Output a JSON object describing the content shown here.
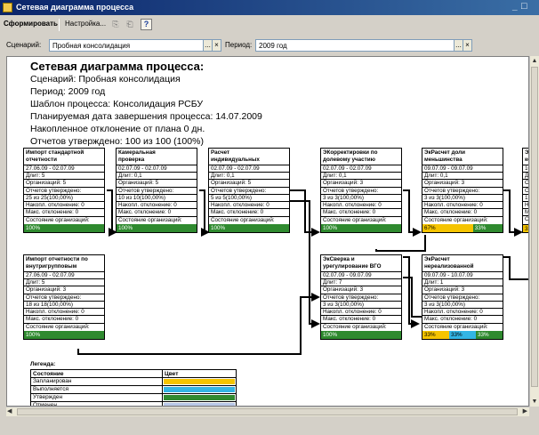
{
  "window": {
    "title": "Сетевая диаграмма процесса"
  },
  "toolbar": {
    "generate_label": "Сформировать",
    "settings_label": "Настройка...",
    "help_label": "?"
  },
  "params": {
    "scenario_label": "Сценарий:",
    "scenario_value": "Пробная консолидация",
    "period_label": "Период:",
    "period_value": "2009 год",
    "btn_select": "...",
    "btn_clear": "×"
  },
  "report": {
    "heading": "Сетевая диаграмма процесса:",
    "scenario": "Сценарий: Пробная консолидация",
    "period": "Период: 2009 год",
    "template": "Шаблон процесса: Консолидация РСБУ",
    "planned_end": "Планируемая дата завершения процесса: 14.07.2009",
    "deviation": "Накопленное отклонение от плана 0 дн.",
    "approved": "Отчетов утверждено: 100 из 100 (100%)"
  },
  "status_label": "Состояние организаций:",
  "colors": {
    "done": "#2f8a2f",
    "planned": "#f5c400",
    "in_progress": "#33b5e5",
    "approved": "#2f8a2f",
    "cancelled": "#b9c8e8",
    "suspended": "#6e6e6e"
  },
  "boxes": [
    {
      "id": "b1",
      "title1": "Импорт стандартной",
      "title2": "отчетности",
      "dates": "27.06.09 - 02.07.09",
      "duration": "Длит: 5",
      "orgs": "Организаций: 5",
      "approved_label": "Отчетов утверждено:",
      "approved_value": "25 из 25(100,00%)",
      "acc_dev": "Накопл. отклонение: 0",
      "max_dev": "Макс. отклонение: 0",
      "segments": [
        {
          "text": "100%",
          "color": "done"
        }
      ]
    },
    {
      "id": "b2",
      "title1": "Камеральная",
      "title2": "проверка",
      "dates": "02.07.09 - 02.07.09",
      "duration": "Длит: 0,1",
      "orgs": "Организаций: 5",
      "approved_label": "Отчетов утверждено:",
      "approved_value": "10 из 10(100,00%)",
      "acc_dev": "Накопл. отклонение: 0",
      "max_dev": "Макс. отклонение: 0",
      "segments": [
        {
          "text": "100%",
          "color": "done"
        }
      ]
    },
    {
      "id": "b3",
      "title1": "Расчет",
      "title2": "индивидуальных",
      "dates": "02.07.09 - 02.07.09",
      "duration": "Длит: 0,1",
      "orgs": "Организаций: 5",
      "approved_label": "Отчетов утверждено:",
      "approved_value": "5 из 5(100,00%)",
      "acc_dev": "Накопл. отклонение: 0",
      "max_dev": "Макс. отклонение: 0",
      "segments": [
        {
          "text": "100%",
          "color": "done"
        }
      ]
    },
    {
      "id": "b4",
      "title1": "ЭКорректировки по",
      "title2": "долевому участию",
      "dates": "02.07.09 - 02.07.09",
      "duration": "Длит: 0,1",
      "orgs": "Организаций: 3",
      "approved_label": "Отчетов утверждено:",
      "approved_value": "3 из 3(100,00%)",
      "acc_dev": "Накопл. отклонение: 0",
      "max_dev": "Макс. отклонение: 0",
      "segments": [
        {
          "text": "100%",
          "color": "done"
        }
      ]
    },
    {
      "id": "b5",
      "title1": "ЭкРасчет доли",
      "title2": "меньшинства",
      "dates": "09.07.09 - 09.07.09",
      "duration": "Длит: 0,1",
      "orgs": "Организаций: 3",
      "approved_label": "Отчетов утверждено:",
      "approved_value": "3 из 3(100,00%)",
      "acc_dev": "Накопл. отклонение: 0",
      "max_dev": "Макс. отклонение: 0",
      "segments": [
        {
          "text": "67%",
          "color": "planned"
        },
        {
          "text": "33%",
          "color": "done"
        }
      ]
    },
    {
      "id": "b6",
      "title1": "Импорт отчетности по",
      "title2": "внутригрупповым",
      "dates": "27.06.09 - 02.07.09",
      "duration": "Длит: 5",
      "orgs": "Организаций: 3",
      "approved_label": "Отчетов утверждено:",
      "approved_value": "18 из 18(100,00%)",
      "acc_dev": "Накопл. отклонение: 0",
      "max_dev": "Макс. отклонение: 0",
      "segments": [
        {
          "text": "100%",
          "color": "done"
        }
      ]
    },
    {
      "id": "b7",
      "title1": "ЭкСверка и",
      "title2": "урегулирование ВГО",
      "dates": "02.07.09 - 09.07.09",
      "duration": "Длит: 7",
      "orgs": "Организаций: 3",
      "approved_label": "Отчетов утверждено:",
      "approved_value": "3 из 3(100,00%)",
      "acc_dev": "Накопл. отклонение: 0",
      "max_dev": "Макс. отклонение: 0",
      "segments": [
        {
          "text": "100%",
          "color": "done"
        }
      ]
    },
    {
      "id": "b8",
      "title1": "ЭкРасчет",
      "title2": "нереализованной",
      "dates": "09.07.09 - 10.07.09",
      "duration": "Длит: 1",
      "orgs": "Организаций: 3",
      "approved_label": "Отчетов утверждено:",
      "approved_value": "3 из 3(100,00%)",
      "acc_dev": "Накопл. отклонение: 0",
      "max_dev": "Макс. отклонение: 0",
      "segments": [
        {
          "text": "33%",
          "color": "planned"
        },
        {
          "text": "33%",
          "color": "in_progress"
        },
        {
          "text": "33%",
          "color": "done"
        }
      ]
    }
  ],
  "partial_box": {
    "title1": "Э",
    "title2": "ко",
    "lines": [
      "10",
      "Дл",
      "Ор",
      "От",
      "15",
      "На",
      "Ма",
      "Со"
    ],
    "segment": "33"
  },
  "legend": {
    "title": "Легенда:",
    "col_state": "Состояние",
    "col_color": "Цвет",
    "rows": [
      {
        "label": "Запланирован",
        "color": "planned"
      },
      {
        "label": "Выполняется",
        "color": "in_progress"
      },
      {
        "label": "Утвержден",
        "color": "approved"
      },
      {
        "label": "Отменен",
        "color": "cancelled"
      },
      {
        "label": "Приостановлен",
        "color": "suspended"
      }
    ]
  }
}
